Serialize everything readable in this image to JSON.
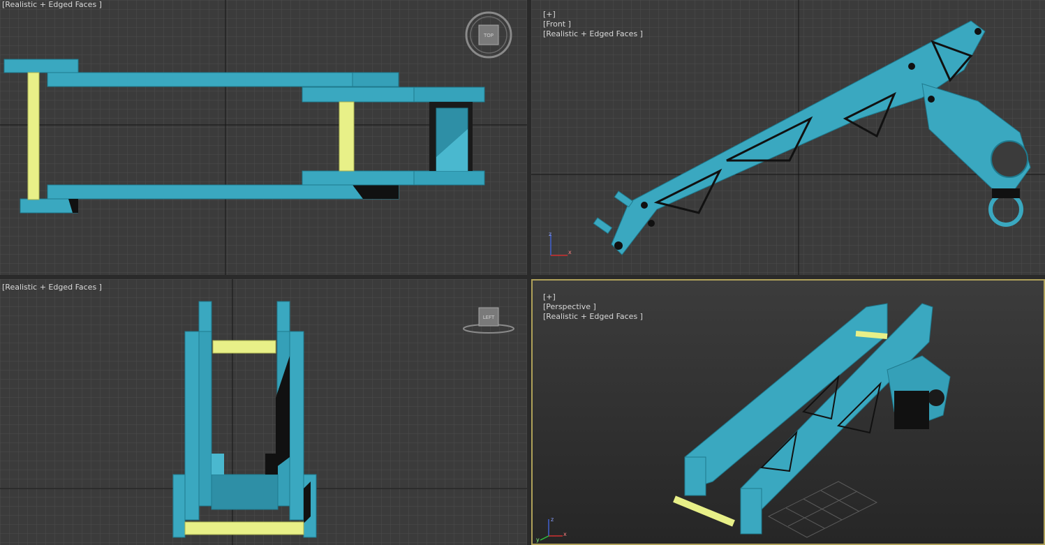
{
  "viewports": {
    "top_left": {
      "label": "[Realistic + Edged Faces ]",
      "navcube": "TOP"
    },
    "top_right": {
      "label_parts": [
        "[+]",
        "[Front ]",
        "[Realistic + Edged Faces ]"
      ]
    },
    "bottom_left": {
      "label": "[Realistic + Edged Faces ]",
      "navcube": "LEFT"
    },
    "bottom_right": {
      "label_parts": [
        "[+]",
        "[Perspective ]",
        "[Realistic + Edged Faces ]"
      ]
    }
  },
  "axis_gizmo": {
    "x": "x",
    "y": "y",
    "z": "z"
  },
  "colors": {
    "model": "#3aa8c0",
    "model_dark": "#2a8aa0",
    "pin": "#e8f088",
    "grid_line": "#4a4a4a",
    "grid_major": "#141414",
    "active_border": "#b0a25a"
  }
}
